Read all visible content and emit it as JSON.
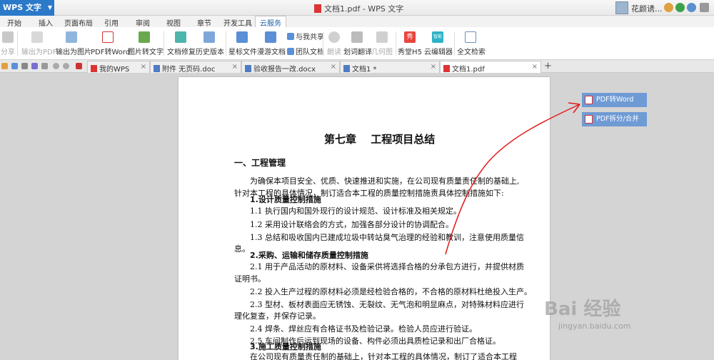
{
  "app": {
    "name": "WPS 文字",
    "window_title": "文档1.pdf - WPS 文字",
    "user": "花颜诱..."
  },
  "menu_tabs": [
    "开始",
    "插入",
    "页面布局",
    "引用",
    "审阅",
    "视图",
    "章节",
    "开发工具",
    "云服务"
  ],
  "active_menu_tab": "云服务",
  "ribbon": {
    "share": "分享",
    "export_pdf": "输出为PDF",
    "export_image": "输出为图片",
    "pdf_to_word": "PDF转Word",
    "image_to_text": "图片转文字",
    "doc_repair": "文档修复",
    "history": "历史版本",
    "starred": "星标文件",
    "roaming": "漫游文档",
    "share_with_me": "与我共享",
    "team_docs": "团队文档",
    "read_aloud": "朗读",
    "translate": "划词翻译",
    "geometry": "几何图",
    "xiuge_h5": "秀堂H5",
    "cloud_editor": "云编辑器",
    "full_search": "全文检索",
    "smart_label": "智能"
  },
  "doc_tabs": [
    {
      "label": "我的WPS"
    },
    {
      "label": "附件 无页码.doc"
    },
    {
      "label": "验收报告一改.docx"
    },
    {
      "label": "文档1 *"
    },
    {
      "label": "文档1.pdf"
    }
  ],
  "side_buttons": {
    "pdf_to_word": "PDF转Word",
    "pdf_split": "PDF拆分/合并"
  },
  "document": {
    "chapter": "第七章　 工程项目总结",
    "section1": "一、工程管理",
    "intro1": "为确保本项目安全、优质、快速推进和实施，在公司现有质量责任制的基础上,",
    "intro2": "针对本工程的具体情况，制订适合本工程的质量控制措施责具体控制措施如下:",
    "s1": "1.设计质量控制措施",
    "s1_1": "1.1 执行国内和国外现行的设计规范、设计标准及相关规定。",
    "s1_2": "1.2 采用设计联络会的方式，加强各部分设计的协调配合。",
    "s1_3": "1.3 总结和吸收国内已建成垃圾中转站臭气治理的经验和教训，注意使用质量信",
    "s1_3b": "息。",
    "s2": "2.采购、运输和储存质量控制措施",
    "s2_1": "2.1 用于产品活动的原材料、设备采供将选择合格的分承包方进行，并提供材质",
    "s2_1b": "证明书。",
    "s2_2": "2.2 投入生产过程的原材料必须是经检验合格的，不合格的原材料杜绝投入生产。",
    "s2_3": "2.3 型材、板材表面应无锈蚀、无裂纹、无气泡和明显麻点，对特殊材料应进行",
    "s2_3b": "理化复查，并保存记录。",
    "s2_4": "2.4 焊条、焊丝应有合格证书及检验记录。检验人员应进行验证。",
    "s2_5": "2.5 车间制作后运到现场的设备、构件必须出具质检记录和出厂合格证。",
    "s3": "3.施工质量控制措施",
    "s3_1": "在公司现有质量责任制的基础上，针对本工程的具体情况，制订了适合本工程"
  },
  "watermark": {
    "brand": "Bai 经验",
    "url": "jingyan.baidu.com"
  },
  "colors": {
    "app_blue": "#2b79c9",
    "side_button": "#6f9bd5",
    "annotation": "#e21b1b"
  }
}
